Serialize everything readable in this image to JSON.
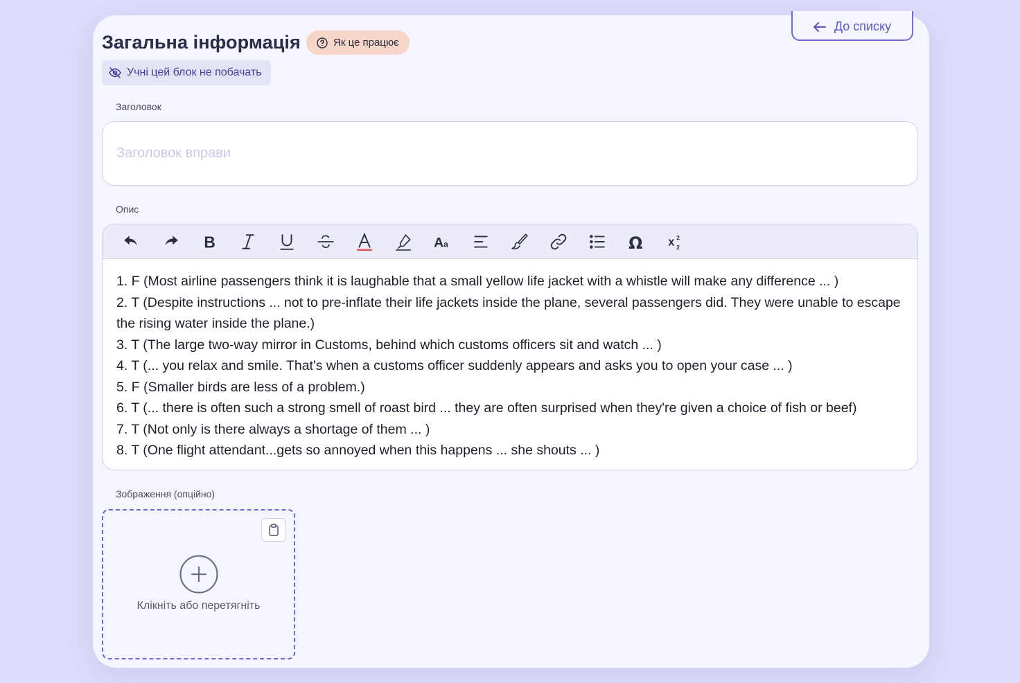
{
  "header": {
    "back_label": "До списку",
    "title": "Загальна інформація",
    "how_it_works": "Як це працює",
    "hidden_note": "Учні цей блок не побачать"
  },
  "title_field": {
    "label": "Заголовок",
    "placeholder": "Заголовок вправи",
    "value": ""
  },
  "description": {
    "label": "Опис",
    "toolbar": [
      "undo-icon",
      "redo-icon",
      "bold-icon",
      "italic-icon",
      "underline-icon",
      "strikethrough-icon",
      "font-color-icon",
      "highlight-icon",
      "font-size-icon",
      "align-icon",
      "format-painter-icon",
      "link-icon",
      "bullet-list-icon",
      "special-char-icon",
      "sub-superscript-icon"
    ],
    "lines": [
      "1. F (Most airline passengers think it is laughable that a small yellow life jacket with a whistle will make any difference ... )",
      "2. T (Despite instructions ... not to pre-inflate their life jackets inside the plane, several passengers did. They were unable to escape the rising water inside the plane.)",
      "3. T (The large two-way mirror in Customs, behind which customs officers sit and watch ... )",
      "4. T (... you relax and smile. That's when a customs officer suddenly appears and asks you to open your case ... )",
      "5. F (Smaller birds are less of a problem.)",
      "6. T (... there is often such a strong smell of roast bird ... they are often surprised when they're given a choice of fish or beef)",
      "7. T (Not only is there always a shortage of them ... )",
      "8. T (One flight attendant...gets so annoyed when this happens ... she shouts ... )"
    ]
  },
  "image": {
    "label": "Зображення (опційно)",
    "drop_text": "Клікніть або перетягніть"
  },
  "colors": {
    "accent": "#5b57c4",
    "badge_bg": "#f6d6c8",
    "page_bg": "#dcdcfa",
    "card_bg": "#f5f5fd"
  }
}
